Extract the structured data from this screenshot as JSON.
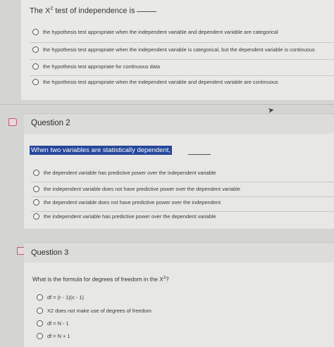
{
  "question1": {
    "prompt_lead": "The X",
    "prompt_sup": "2",
    "prompt_tail": " test of independence is",
    "options": [
      "the hypothesis test appropriate when the independent variable and dependent variable are categorical",
      "the hypothesis test appropriate when the independent variable is categorical, but the dependent variable is continuous",
      "the hypothesis test appropriate for continuous data",
      "the hypothesis test appropriate when the independent variable and dependent variable are continuous"
    ]
  },
  "question2": {
    "title": "Question 2",
    "prompt": "When two variables are statistically dependent,",
    "options": [
      "the dependent variable has predictive power over the independent variable",
      "the independent variable does not have predictive power over the dependent variable",
      "the dependent variable does not have predictive power over the independent",
      "the independent variable has predictive power over the dependent variable"
    ]
  },
  "question3": {
    "title": "Question 3",
    "prompt_lead": "What is the formula for degrees of freedom in the X",
    "prompt_sup": "2",
    "prompt_tail": "?",
    "options": [
      "df = (r - 1)(c - 1)",
      "X2 does not make use of degrees of freedom",
      "df = N - 1",
      "df = N + 1"
    ]
  },
  "icons": {
    "flag": "flag-icon",
    "cursor": "cursor-icon"
  }
}
